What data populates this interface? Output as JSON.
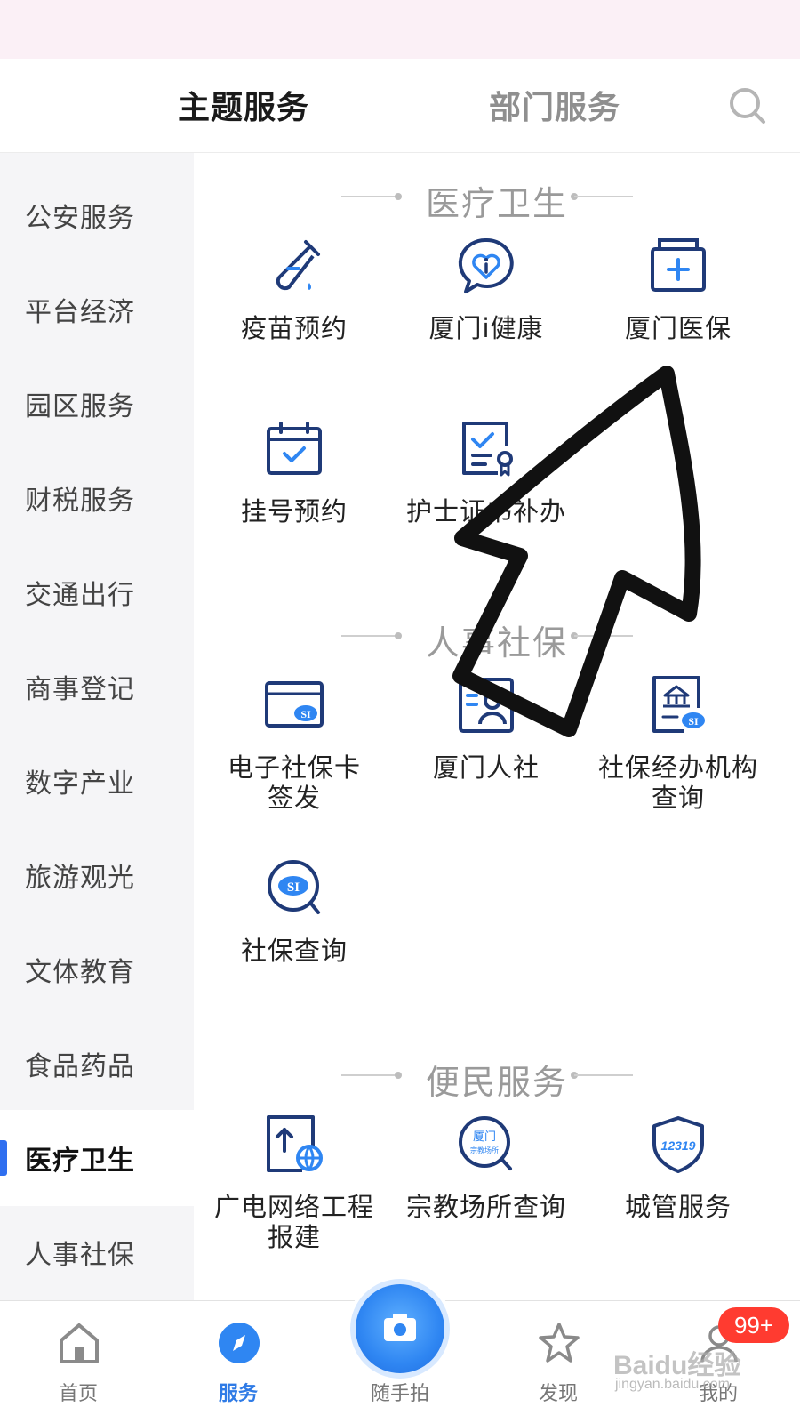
{
  "top_tabs": {
    "topic": "主题服务",
    "department": "部门服务"
  },
  "sidebar": {
    "items": [
      {
        "label": "公安服务"
      },
      {
        "label": "平台经济"
      },
      {
        "label": "园区服务"
      },
      {
        "label": "财税服务"
      },
      {
        "label": "交通出行"
      },
      {
        "label": "商事登记"
      },
      {
        "label": "数字产业"
      },
      {
        "label": "旅游观光"
      },
      {
        "label": "文体教育"
      },
      {
        "label": "食品药品"
      },
      {
        "label": "医疗卫生"
      },
      {
        "label": "人事社保"
      }
    ],
    "active": "医疗卫生"
  },
  "sections": [
    {
      "title": "医疗卫生",
      "services": [
        {
          "label": "疫苗预约",
          "icon": "test-tube-icon"
        },
        {
          "label": "厦门i健康",
          "icon": "heart-chat-icon"
        },
        {
          "label": "厦门医保",
          "icon": "medical-kit-icon"
        },
        {
          "label": "挂号预约",
          "icon": "calendar-check-icon"
        },
        {
          "label": "护士证书补办",
          "icon": "certificate-icon"
        }
      ]
    },
    {
      "title": "人事社保",
      "services": [
        {
          "label": "电子社保卡签发",
          "label_line1": "电子社保卡",
          "label_line2": "签发",
          "icon": "social-security-card-icon"
        },
        {
          "label": "厦门人社",
          "icon": "id-card-icon"
        },
        {
          "label": "社保经办机构查询",
          "label_line1": "社保经办机构",
          "label_line2": "查询",
          "icon": "institution-doc-icon"
        },
        {
          "label": "社保查询",
          "icon": "social-security-search-icon"
        }
      ]
    },
    {
      "title": "便民服务",
      "services": [
        {
          "label": "广电网络工程报建",
          "label_line1": "广电网络工程",
          "label_line2": "报建",
          "icon": "upload-globe-icon"
        },
        {
          "label": "宗教场所查询",
          "icon": "religious-search-icon",
          "icon_text_1": "厦门",
          "icon_text_2": "宗教场所"
        },
        {
          "label": "城管服务",
          "icon": "shield-12319-icon",
          "icon_text": "12319"
        }
      ]
    }
  ],
  "bottom_nav": {
    "home": "首页",
    "services": "服务",
    "snapshot": "随手拍",
    "discover": "发现",
    "mine": "我的",
    "badge": "99+"
  },
  "watermark": {
    "main": "Baidu经验",
    "sub": "jingyan.baidu.com"
  },
  "colors": {
    "accent": "#2f7be6",
    "icon": "#1f3a78",
    "icon_accent": "#2f86f2",
    "badge": "#ff3b30"
  }
}
